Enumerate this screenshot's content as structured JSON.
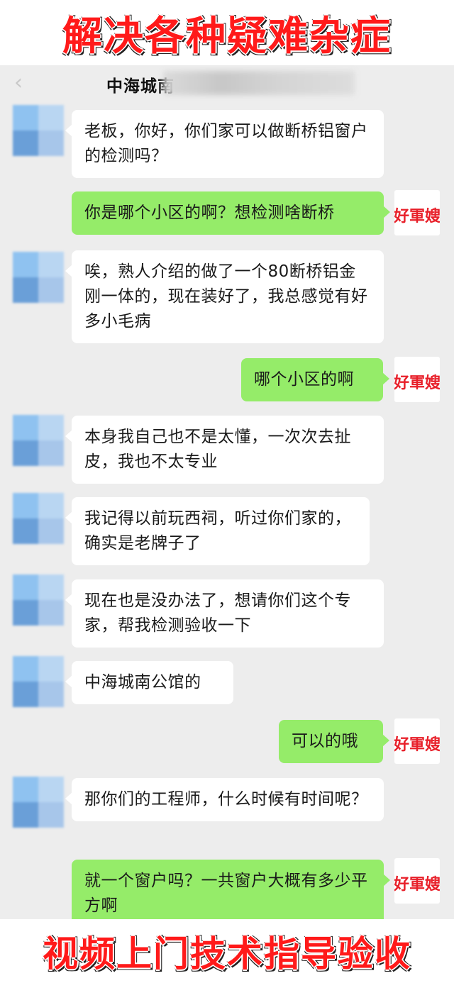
{
  "banners": {
    "top": "解决各种疑难杂症",
    "bottom": "视频上门技术指导验收"
  },
  "header": {
    "title": "中海城南",
    "back_icon": "chevron-left-icon"
  },
  "brand_avatar": {
    "text": "好軍嫂",
    "color": "#e8202a"
  },
  "colors": {
    "incoming_bubble": "#ffffff",
    "outgoing_bubble": "#95ec69",
    "banner_text": "#ff1a1a"
  },
  "messages": [
    {
      "side": "in",
      "text": "老板，你好，你们家可以做断桥铝窗户的检测吗？"
    },
    {
      "side": "out",
      "text": "你是哪个小区的啊？想检测啥断桥"
    },
    {
      "side": "in",
      "text": "唉，熟人介绍的做了一个80断桥铝金刚一体的，现在装好了，我总感觉有好多小毛病"
    },
    {
      "side": "out",
      "text": "哪个小区的啊"
    },
    {
      "side": "in",
      "text": "本身我自己也不是太懂，一次次去扯皮，我也不太专业"
    },
    {
      "side": "in",
      "text": "我记得以前玩西祠，听过你们家的，确实是老牌子了"
    },
    {
      "side": "in",
      "text": "现在也是没办法了，想请你们这个专家，帮我检测验收一下"
    },
    {
      "side": "in",
      "text": "中海城南公馆的"
    },
    {
      "side": "out",
      "text": "可以的哦"
    },
    {
      "side": "in",
      "text": "那你们的工程师，什么时候有时间呢？"
    },
    {
      "side": "out",
      "text": "就一个窗户吗？一共窗户大概有多少平方啊"
    }
  ]
}
